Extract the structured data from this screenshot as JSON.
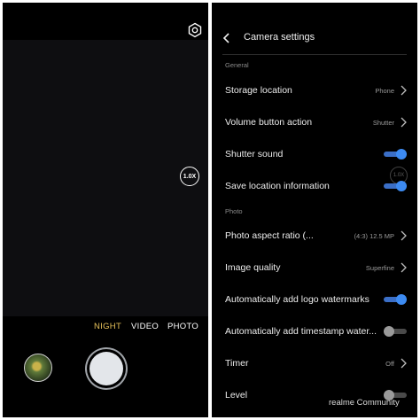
{
  "camera": {
    "settings_icon": "gear-icon",
    "zoom_label": "1.0X",
    "modes": [
      "NIGHT",
      "VIDEO",
      "PHOTO"
    ],
    "active_mode": "NIGHT",
    "accent_color": "#e6c15a"
  },
  "settings": {
    "title": "Camera settings",
    "back_icon": "chevron-left-icon",
    "sections": {
      "general": "General",
      "photo": "Photo"
    },
    "rows": [
      {
        "label": "Storage location",
        "value": "Phone",
        "control": "chevron"
      },
      {
        "label": "Volume button action",
        "value": "Shutter",
        "control": "chevron"
      },
      {
        "label": "Shutter sound",
        "control": "toggle",
        "on": true
      },
      {
        "label": "Save location information",
        "control": "toggle",
        "on": true
      },
      {
        "label": "Photo aspect ratio (...",
        "value": "(4:3) 12.5 MP",
        "control": "chevron"
      },
      {
        "label": "Image quality",
        "value": "Superfine",
        "control": "chevron"
      },
      {
        "label": "Automatically add logo watermarks",
        "control": "toggle",
        "on": true
      },
      {
        "label": "Automatically add timestamp water...",
        "control": "toggle",
        "on": false
      },
      {
        "label": "Timer",
        "value": "Off",
        "control": "chevron"
      },
      {
        "label": "Level",
        "control": "toggle",
        "on": false
      }
    ],
    "overlay_zoom_label": "1.0X",
    "watermark": "realme Community",
    "toggle_on_color": "#3d8bf2"
  }
}
